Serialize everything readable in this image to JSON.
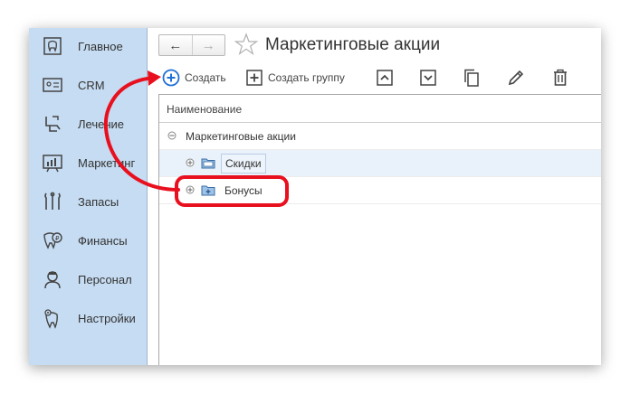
{
  "sidebar": {
    "items": [
      {
        "label": "Главное",
        "icon": "home-tooth-icon"
      },
      {
        "label": "CRM",
        "icon": "crm-card-icon"
      },
      {
        "label": "Лечение",
        "icon": "dental-chair-icon"
      },
      {
        "label": "Маркетинг",
        "icon": "chart-board-icon"
      },
      {
        "label": "Запасы",
        "icon": "dental-tools-icon"
      },
      {
        "label": "Финансы",
        "icon": "tooth-coin-icon"
      },
      {
        "label": "Персонал",
        "icon": "doctor-icon"
      },
      {
        "label": "Настройки",
        "icon": "tooth-gear-icon"
      }
    ]
  },
  "header": {
    "title": "Маркетинговые акции"
  },
  "toolbar": {
    "create_label": "Создать",
    "create_group_label": "Создать группу"
  },
  "grid": {
    "column_header": "Наименование",
    "rows": [
      {
        "label": "Маркетинговые акции"
      },
      {
        "label": "Скидки"
      },
      {
        "label": "Бонусы"
      }
    ]
  },
  "colors": {
    "sidebar_bg": "#c6dcf2",
    "accent_blue": "#1e6fd6",
    "annotation_red": "#e8101e"
  }
}
